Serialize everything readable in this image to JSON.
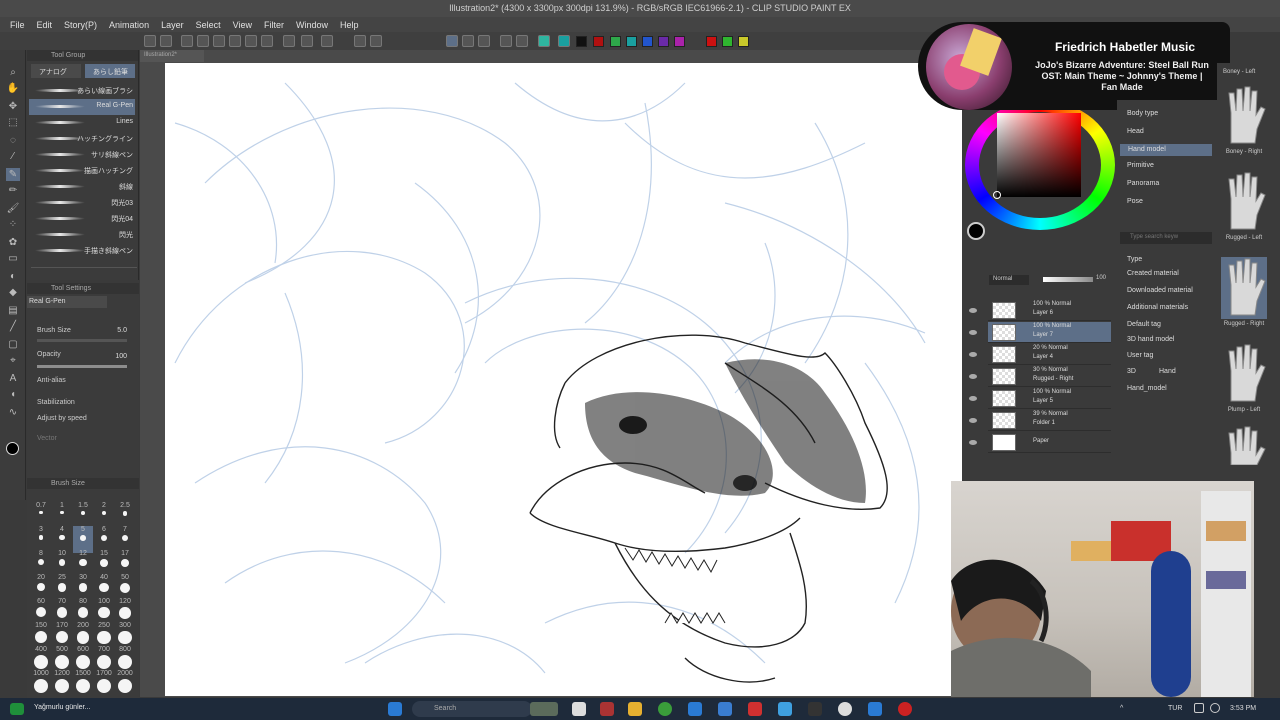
{
  "window": {
    "title": "Illustration2* (4300 x 3300px 300dpi 131.9%) - RGB/sRGB IEC61966-2.1) - CLIP STUDIO PAINT EX"
  },
  "menu": [
    "File",
    "Edit",
    "Story(P)",
    "Animation",
    "Layer",
    "Select",
    "View",
    "Filter",
    "Window",
    "Help"
  ],
  "canvas_tab": "Illustration2*",
  "toolbar": {
    "swatch_colors": [
      "#111111",
      "#b01010",
      "#2ea84a",
      "#1aa0a0",
      "#2255cc",
      "#6a2aa8",
      "#aa22aa",
      "#cc1111",
      "#2fb52f",
      "#c9c92a"
    ]
  },
  "brush_panel": {
    "header": "Tool Group",
    "tabs": [
      "アナログ",
      "あらし鉛筆"
    ],
    "brushes": [
      {
        "name": "あらい線画ブラシ",
        "selected": false
      },
      {
        "name": "Real G-Pen",
        "selected": true
      },
      {
        "name": "Lines",
        "selected": false
      },
      {
        "name": "ハッチングライン",
        "selected": false
      },
      {
        "name": "サリ斜線ペン",
        "selected": false
      },
      {
        "name": "描画ハッチング",
        "selected": false
      },
      {
        "name": "斜線",
        "selected": false
      },
      {
        "name": "閃光03",
        "selected": false
      },
      {
        "name": "閃光04",
        "selected": false
      },
      {
        "name": "閃光",
        "selected": false
      },
      {
        "name": "手描き斜線ペン",
        "selected": false
      }
    ]
  },
  "tool_settings": {
    "header": "Tool Settings",
    "current": "Real G-Pen",
    "brush_size_label": "Brush Size",
    "brush_size": "5.0",
    "opacity_label": "Opacity",
    "opacity": "100",
    "antialias_label": "Anti-alias",
    "stabilization_label": "Stabilization",
    "adjust_label": "Adjust by speed",
    "vector_label": "Vector"
  },
  "brush_size_panel": {
    "header": "Brush Size",
    "sizes": [
      "0.7",
      "1",
      "1.5",
      "2",
      "2.5",
      "3",
      "4",
      "5",
      "6",
      "7",
      "8",
      "10",
      "12",
      "15",
      "17",
      "20",
      "25",
      "30",
      "40",
      "50",
      "60",
      "70",
      "80",
      "100",
      "120",
      "150",
      "170",
      "200",
      "250",
      "300",
      "400",
      "500",
      "600",
      "700",
      "800",
      "1000",
      "1200",
      "1500",
      "1700",
      "2000"
    ],
    "selected": "5"
  },
  "spotify": {
    "artist": "Friedrich Habetler Music",
    "track": "JoJo's Bizarre Adventure: Steel Ball Run OST: Main Theme ~ Johnny's Theme | Fan Made"
  },
  "material_panel": {
    "search_placeholder": "Type search keyw",
    "categories": [
      {
        "label": "Body type",
        "selected": false
      },
      {
        "label": "Head",
        "selected": false
      },
      {
        "label": "Hand model",
        "selected": true
      },
      {
        "label": "Primitive",
        "selected": false
      },
      {
        "label": "Panorama",
        "selected": false
      },
      {
        "label": "Pose",
        "selected": false
      }
    ],
    "type_header": "Type",
    "types": [
      "Created material",
      "Downloaded material",
      "Additional materials"
    ],
    "default_tag_header": "Default tag",
    "default_tag": "3D hand model",
    "user_tag_header": "User tag",
    "user_tags": [
      "3D",
      "Hand",
      "Hand_model"
    ]
  },
  "hand_list": [
    {
      "label": "Boney - Right"
    },
    {
      "label": "Rugged - Left"
    },
    {
      "label": "Rugged - Right"
    },
    {
      "label": "Plump - Left"
    }
  ],
  "hand_list_top_label": "Boney - Left",
  "layer_panel": {
    "blend_mode": "Normal",
    "opacity": "100",
    "layers": [
      {
        "mode": "100 % Normal",
        "name": "Layer 6",
        "selected": false
      },
      {
        "mode": "100 % Normal",
        "name": "Layer 7",
        "selected": true
      },
      {
        "mode": "20 % Normal",
        "name": "Layer 4",
        "selected": false
      },
      {
        "mode": "30 % Normal",
        "name": "Rugged - Right",
        "selected": false
      },
      {
        "mode": "100 % Normal",
        "name": "Layer 5",
        "selected": false
      },
      {
        "mode": "39 % Normal",
        "name": "Folder 1",
        "selected": false
      },
      {
        "mode": "",
        "name": "Paper",
        "selected": false
      }
    ]
  },
  "taskbar": {
    "weather": "Yağmurlu günler...",
    "search": "Search",
    "lang": "TUR",
    "time": "3:53 PM"
  }
}
